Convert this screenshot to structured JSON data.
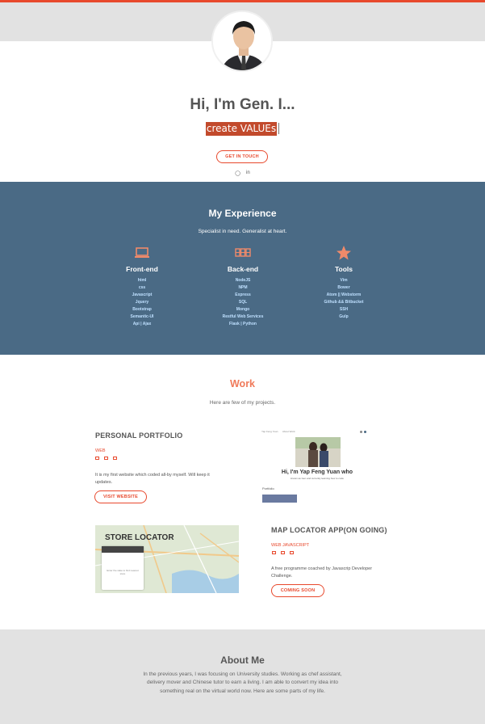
{
  "hero": {
    "title": "Hi, I'm Gen. I...",
    "typed": "create VALUEs",
    "cta_label": "GET IN TOUCH",
    "social": [
      {
        "icon": "github-icon",
        "glyph": "◯"
      },
      {
        "icon": "linkedin-icon",
        "glyph": "in"
      }
    ]
  },
  "experience": {
    "title": "My Experience",
    "subtitle": "Specialist in need. Generalist at heart.",
    "columns": [
      {
        "icon": "laptop-icon",
        "heading": "Front-end",
        "items": [
          "html",
          "css",
          "Javascript",
          "Jquery",
          "Bootstrap",
          "Semantic-UI",
          "Api | Ajax"
        ]
      },
      {
        "icon": "server-icon",
        "heading": "Back-end",
        "items": [
          "NodeJS",
          "NPM",
          "Express",
          "SQL",
          "Mongo",
          "Restful Web Services",
          "Flask | Python"
        ]
      },
      {
        "icon": "star-icon",
        "heading": "Tools",
        "items": [
          "Vim",
          "Bower",
          "Atom || Webstorm",
          "Github && Bitbucket",
          "SSH",
          "Gulp"
        ]
      }
    ]
  },
  "work": {
    "title": "Work",
    "subtitle": "Here are few of my projects.",
    "projects": [
      {
        "name": "PERSONAL PORTFOLIO",
        "tag": "WEB",
        "description": "It is my first website which coded all-by myself. Will keep it updates.",
        "button": "VISIT WEBSITE",
        "screenshot": {
          "nav_left": "Yap Feng Yuan",
          "nav_mid": "About Work",
          "heading": "Hi, I'm Yap Feng Yuan who",
          "subheading": "known as Gen and currently learning how to code",
          "section": "Portfolio"
        }
      },
      {
        "name": "MAP LOCATOR APP(ON GOING)",
        "tag": "WEB JAVASCRIPT",
        "description": "A free programme coached by Javascrip Developer Challenge.",
        "button": "COMING SOON",
        "screenshot": {
          "title": "STORE LOCATOR",
          "card_text": "Enter the state to find nearest store"
        }
      }
    ]
  },
  "about": {
    "title": "About Me",
    "text": "In the previous years, I was focusing on University studies. Working as chef assistant, delivery mover and Chinese tutor to earn a living. I am able to convert my idea into something real on the virtual world now. Here are some parts of my life."
  },
  "colors": {
    "accent": "#e8492d",
    "experience_bg": "#4a6a85",
    "gray_band": "#e2e2e2",
    "skill_text": "#bfe0ff"
  }
}
